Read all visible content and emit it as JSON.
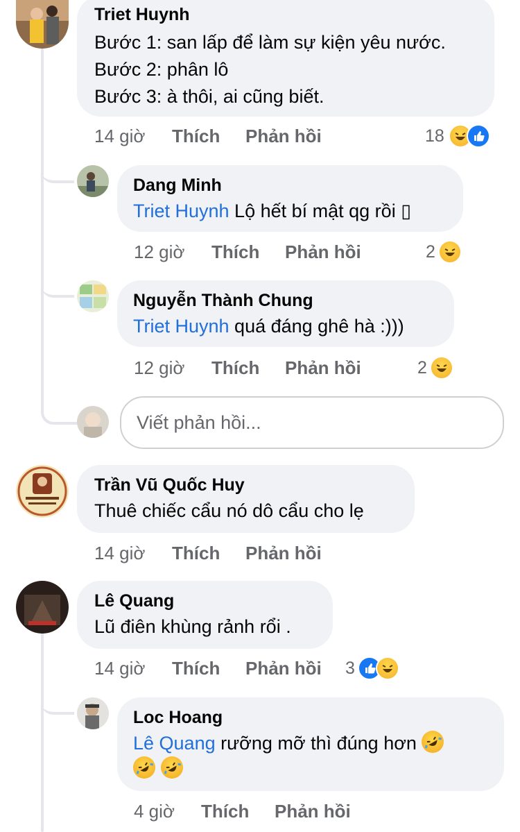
{
  "comments": [
    {
      "author": "Triet Huynh",
      "lines": [
        "Bước 1: san lấp để làm sự kiện yêu nước.",
        "Bước 2: phân lô",
        "Bước 3: à thôi, ai cũng biết."
      ],
      "time": "14 giờ",
      "like": "Thích",
      "reply": "Phản hồi",
      "reaction_count": "18",
      "reactions": [
        "haha-icon",
        "like-icon"
      ]
    },
    {
      "author": "Dang Minh",
      "mention": "Triet Huynh",
      "text": " Lộ hết bí mật qg rồi ▯",
      "time": "12 giờ",
      "like": "Thích",
      "reply": "Phản hồi",
      "reaction_count": "2",
      "reactions": [
        "haha-icon"
      ]
    },
    {
      "author": "Nguyễn Thành Chung",
      "mention": "Triet Huynh",
      "text": " quá đáng ghê hà :)))",
      "time": "12 giờ",
      "like": "Thích",
      "reply": "Phản hồi",
      "reaction_count": "2",
      "reactions": [
        "haha-icon"
      ]
    },
    {
      "author": "Trần Vũ Quốc Huy",
      "text": "Thuê chiếc cẩu nó dô cẩu cho lẹ",
      "time": "14 giờ",
      "like": "Thích",
      "reply": "Phản hồi"
    },
    {
      "author": "Lê Quang",
      "text": "Lũ điên khùng rảnh rổi .",
      "time": "14 giờ",
      "like": "Thích",
      "reply": "Phản hồi",
      "reaction_count": "3",
      "reactions": [
        "like-icon",
        "haha-icon"
      ]
    },
    {
      "author": "Loc Hoang",
      "mention": "Lê Quang",
      "text": " rưỡng mỡ thì đúng hơn",
      "time": "4 giờ",
      "like": "Thích",
      "reply": "Phản hồi"
    }
  ],
  "reply_input": {
    "placeholder": "Viết phản hồi..."
  },
  "colors": {
    "bubble": "#f0f2f5",
    "mention": "#216fdb",
    "meta": "#65676b",
    "like_blue": "#1877f2",
    "haha_yellow": "#f7c23a"
  }
}
